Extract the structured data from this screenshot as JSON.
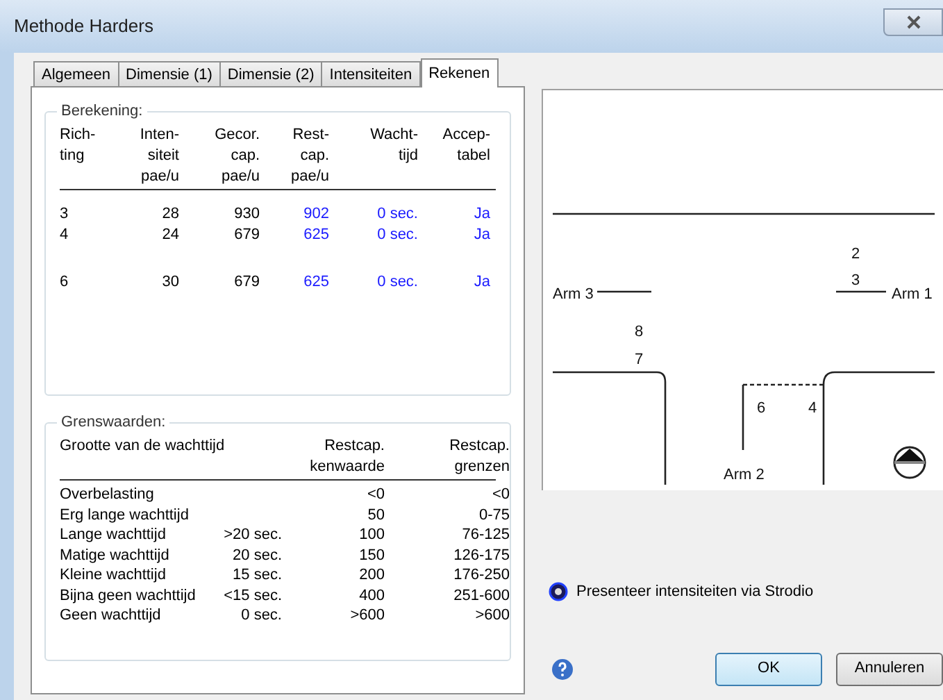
{
  "window": {
    "title": "Methode Harders"
  },
  "tabs": [
    {
      "label": "Algemeen",
      "selected": false
    },
    {
      "label": "Dimensie (1)",
      "selected": false
    },
    {
      "label": "Dimensie (2)",
      "selected": false
    },
    {
      "label": "Intensiteiten",
      "selected": false
    },
    {
      "label": "Rekenen",
      "selected": true
    }
  ],
  "berekening": {
    "title": "Berekening:",
    "columns": [
      "Rich-\nting",
      "Inten-\nsiteit\npae/u",
      "Gecor.\ncap.\npae/u",
      "Rest-\ncap.\npae/u",
      "Wacht-\ntijd",
      "Accep-\ntabel"
    ],
    "rows": [
      {
        "gap_before": false,
        "cells": [
          "3",
          "28",
          "930",
          "902",
          "0 sec.",
          "Ja"
        ]
      },
      {
        "gap_before": false,
        "cells": [
          "4",
          "24",
          "679",
          "625",
          "0 sec.",
          "Ja"
        ]
      },
      {
        "gap_before": true,
        "cells": [
          "6",
          "30",
          "679",
          "625",
          "0 sec.",
          "Ja"
        ]
      }
    ]
  },
  "grenswaarden": {
    "title": "Grenswaarden:",
    "columns": [
      "Grootte van de wachttijd",
      "Restcap.\nkenwaarde",
      "Restcap.\ngrenzen"
    ],
    "rows": [
      {
        "label": "Overbelasting",
        "value": "<0",
        "range": "<0"
      },
      {
        "label": "Erg lange wachttijd",
        "value": "50",
        "range": "0-75"
      },
      {
        "label": "Lange wachttijd",
        "wait": ">20 sec.",
        "value": "100",
        "range": "76-125"
      },
      {
        "label": "Matige wachttijd",
        "wait": "20 sec.",
        "value": "150",
        "range": "126-175"
      },
      {
        "label": "Kleine wachttijd",
        "wait": "15 sec.",
        "value": "200",
        "range": "176-250"
      },
      {
        "label": "Bijna geen wachttijd",
        "wait": "<15 sec.",
        "value": "400",
        "range": "251-600"
      },
      {
        "label": "Geen wachttijd",
        "wait": "0 sec.",
        "value": ">600",
        "range": ">600"
      }
    ]
  },
  "diagram": {
    "arms": [
      "Arm 3",
      "Arm 1",
      "Arm 2"
    ],
    "lanes": [
      "2",
      "3",
      "8",
      "7",
      "6",
      "4"
    ]
  },
  "strodio_link": "Presenteer intensiteiten via Strodio",
  "buttons": [
    "OK",
    "Annuleren"
  ]
}
